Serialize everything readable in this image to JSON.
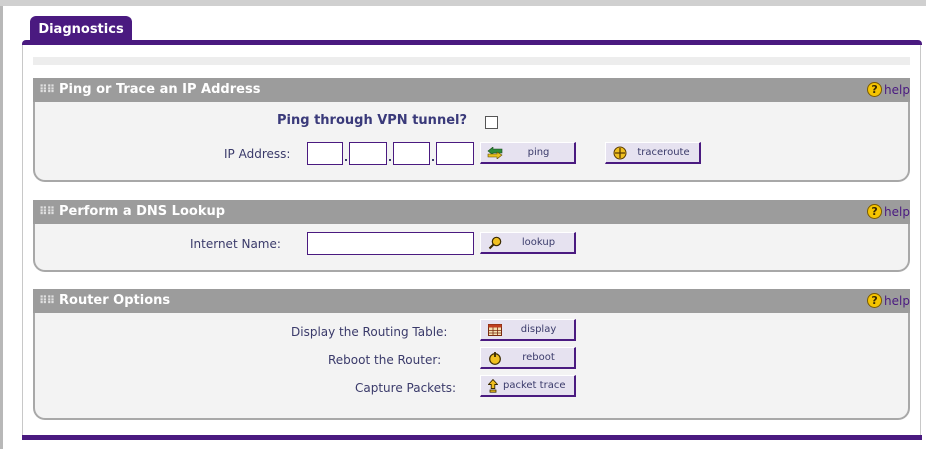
{
  "tab": {
    "label": "Diagnostics"
  },
  "sections": {
    "ping": {
      "title": "Ping or Trace an IP Address",
      "help": "help",
      "vpn_label": "Ping through VPN tunnel?",
      "vpn_checked": false,
      "ip_label": "IP Address:",
      "ip_octets": [
        "",
        "",
        "",
        ""
      ],
      "ping_button": "ping",
      "traceroute_button": "traceroute"
    },
    "dns": {
      "title": "Perform a DNS Lookup",
      "help": "help",
      "name_label": "Internet Name:",
      "name_value": "",
      "lookup_button": "lookup"
    },
    "router": {
      "title": "Router Options",
      "help": "help",
      "routing_label": "Display the Routing Table:",
      "display_button": "display",
      "reboot_label": "Reboot the Router:",
      "reboot_button": "reboot",
      "capture_label": "Capture Packets:",
      "packet_button": "packet trace"
    }
  },
  "colors": {
    "accent": "#4a1a80",
    "header_bg": "#9c9c9c",
    "panel_bg": "#f3f3f3",
    "help_icon": "#f5c400"
  }
}
